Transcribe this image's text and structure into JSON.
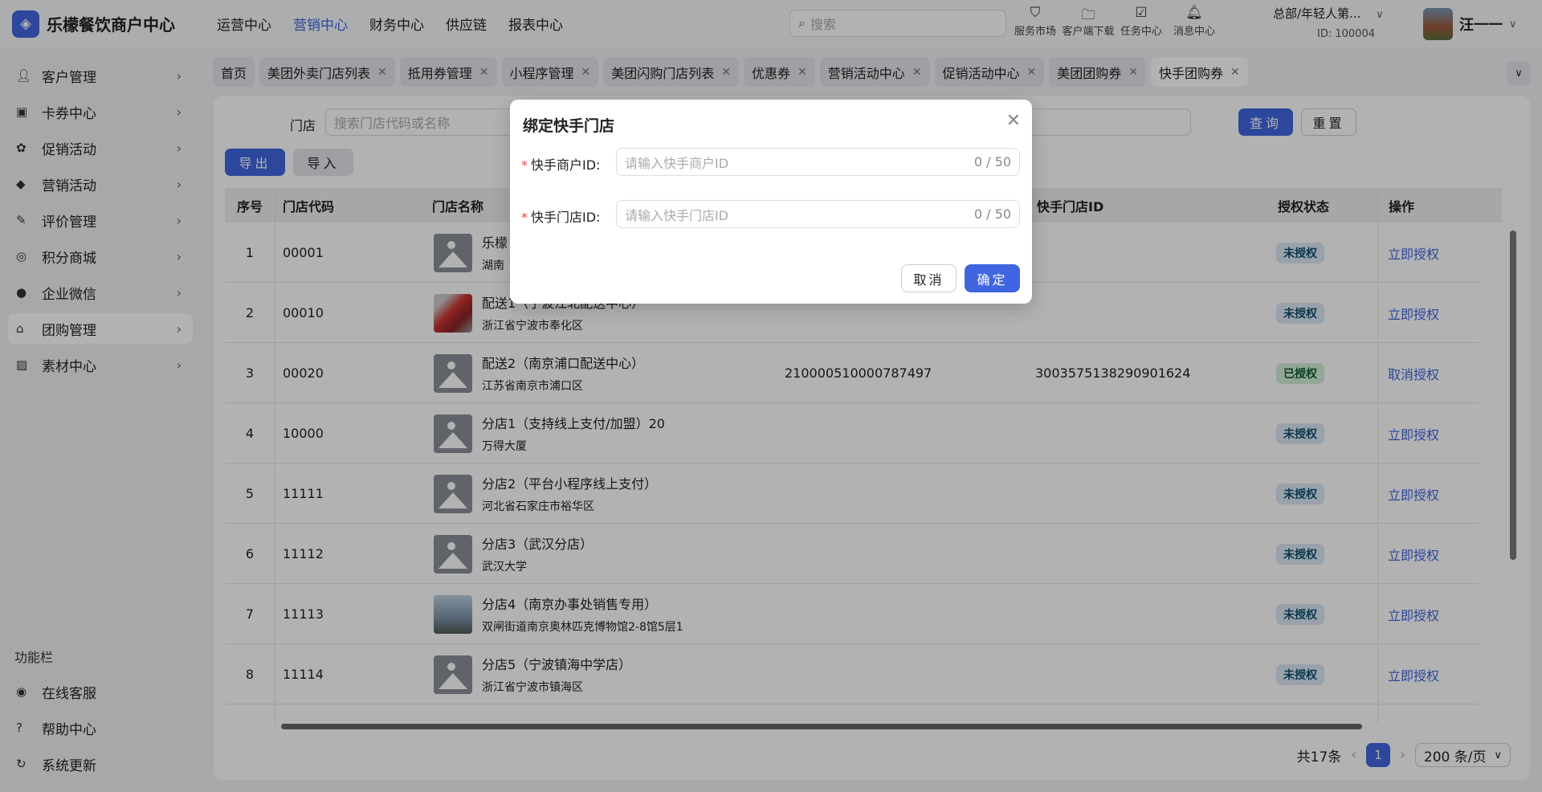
{
  "app": {
    "title": "乐檬餐饮商户中心"
  },
  "topnav": [
    "运营中心",
    "营销中心",
    "财务中心",
    "供应链",
    "报表中心"
  ],
  "search": {
    "placeholder": "搜索"
  },
  "tools": [
    {
      "icon": "bag-icon",
      "label": "服务市场"
    },
    {
      "icon": "folder-download-icon",
      "label": "客户端下载"
    },
    {
      "icon": "clipboard-check-icon",
      "label": "任务中心"
    },
    {
      "icon": "bell-icon",
      "label": "消息中心"
    }
  ],
  "org": {
    "name": "总部/年轻人第...",
    "id": "ID: 100004"
  },
  "user": {
    "name": "汪一一"
  },
  "sidebar": {
    "items": [
      {
        "icon": "user-icon",
        "label": "客户管理"
      },
      {
        "icon": "ticket-icon",
        "label": "卡券中心"
      },
      {
        "icon": "badge-icon",
        "label": "促销活动"
      },
      {
        "icon": "tag-icon",
        "label": "营销活动"
      },
      {
        "icon": "review-icon",
        "label": "评价管理"
      },
      {
        "icon": "coins-icon",
        "label": "积分商城"
      },
      {
        "icon": "chat-icon",
        "label": "企业微信"
      },
      {
        "icon": "shop-icon",
        "label": "团购管理"
      },
      {
        "icon": "image-icon",
        "label": "素材中心"
      }
    ],
    "section": "功能栏",
    "tools": [
      {
        "icon": "headset-icon",
        "label": "在线客服"
      },
      {
        "icon": "help-icon",
        "label": "帮助中心"
      },
      {
        "icon": "refresh-icon",
        "label": "系统更新"
      }
    ]
  },
  "tabs": [
    "首页",
    "美团外卖门店列表",
    "抵用券管理",
    "小程序管理",
    "美团闪购门店列表",
    "优惠券",
    "营销活动中心",
    "促销活动中心",
    "美团团购券",
    "快手团购券"
  ],
  "filter": {
    "label": "门店",
    "placeholder": "搜索门店代码或名称",
    "query": "查询",
    "reset": "重置"
  },
  "actions": {
    "export": "导出",
    "import": "导入"
  },
  "table": {
    "headers": [
      "序号",
      "门店代码",
      "门店名称",
      "快手门店ID",
      "授权状态",
      "操作"
    ],
    "rows": [
      {
        "no": "1",
        "code": "00001",
        "name": "乐檬",
        "addr": "湖南",
        "mid": "",
        "sid": "",
        "status": "未授权",
        "action": "立即授权",
        "img": "ph"
      },
      {
        "no": "2",
        "code": "00010",
        "name": "配送1（宁波江北配送中心）",
        "addr": "浙江省宁波市奉化区",
        "mid": "",
        "sid": "",
        "status": "未授权",
        "action": "立即授权",
        "img": "car"
      },
      {
        "no": "3",
        "code": "00020",
        "name": "配送2（南京浦口配送中心）",
        "addr": "江苏省南京市浦口区",
        "mid": "210000510000787497",
        "sid": "3003575138290901624",
        "status": "已授权",
        "action": "取消授权",
        "img": "ph"
      },
      {
        "no": "4",
        "code": "10000",
        "name": "分店1（支持线上支付/加盟）20",
        "addr": "万得大厦",
        "mid": "",
        "sid": "",
        "status": "未授权",
        "action": "立即授权",
        "img": "ph"
      },
      {
        "no": "5",
        "code": "11111",
        "name": "分店2（平台小程序线上支付）",
        "addr": "河北省石家庄市裕华区",
        "mid": "",
        "sid": "",
        "status": "未授权",
        "action": "立即授权",
        "img": "ph"
      },
      {
        "no": "6",
        "code": "11112",
        "name": "分店3（武汉分店）",
        "addr": "武汉大学",
        "mid": "",
        "sid": "",
        "status": "未授权",
        "action": "立即授权",
        "img": "ph"
      },
      {
        "no": "7",
        "code": "11113",
        "name": "分店4（南京办事处销售专用）",
        "addr": "双闸街道南京奥林匹克博物馆2-8馆5层1",
        "mid": "",
        "sid": "",
        "status": "未授权",
        "action": "立即授权",
        "img": "tower"
      },
      {
        "no": "8",
        "code": "11114",
        "name": "分店5（宁波镇海中学店）",
        "addr": "浙江省宁波市镇海区",
        "mid": "",
        "sid": "",
        "status": "未授权",
        "action": "立即授权",
        "img": "ph"
      }
    ]
  },
  "pagination": {
    "total": "共17条",
    "page": "1",
    "size": "200 条/页"
  },
  "modal": {
    "title": "绑定快手门店",
    "fields": [
      {
        "label": "快手商户ID:",
        "placeholder": "请输入快手商户ID",
        "count": "0 / 50"
      },
      {
        "label": "快手门店ID:",
        "placeholder": "请输入快手门店ID",
        "count": "0 / 50"
      }
    ],
    "cancel": "取消",
    "ok": "确定"
  },
  "colors": {
    "accent": "#3f66e0"
  }
}
